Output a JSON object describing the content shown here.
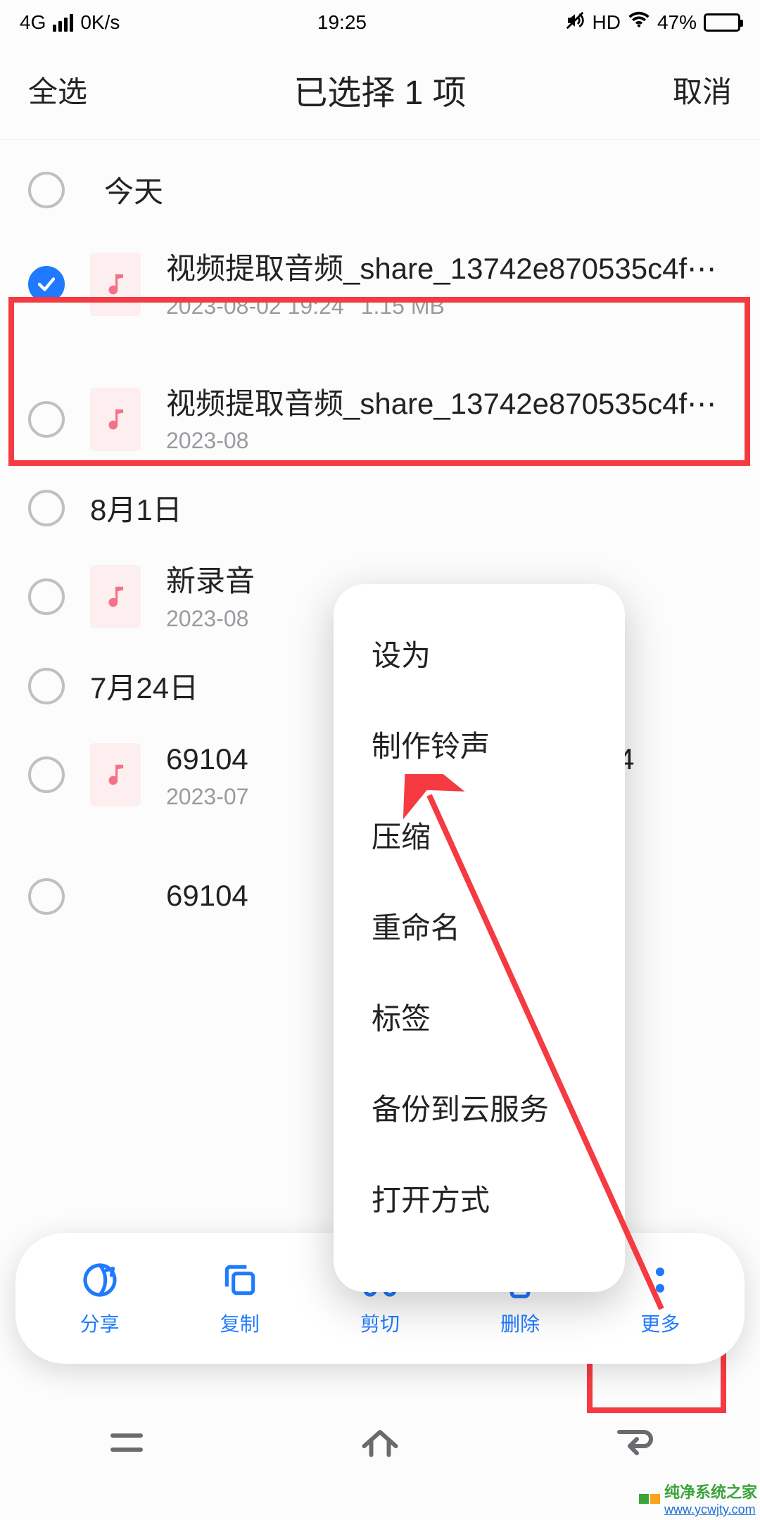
{
  "status_bar": {
    "network": "4G",
    "speed": "0K/s",
    "time": "19:25",
    "hd": "HD",
    "battery_pct": "47%"
  },
  "header": {
    "select_all": "全选",
    "title": "已选择 1 项",
    "cancel": "取消"
  },
  "sections": {
    "today": "今天",
    "aug1": "8月1日",
    "jul24": "7月24日"
  },
  "files": [
    {
      "name": "视频提取音频_share_13742e870535c4f⋯",
      "date": "2023-08-02 19:24",
      "size": "1.15 MB",
      "checked": true
    },
    {
      "name": "视频提取音频_share_13742e870535c4f⋯",
      "date": "2023-08",
      "size": "",
      "checked": false
    },
    {
      "name": "新录音",
      "date": "2023-08",
      "size": "",
      "checked": false
    },
    {
      "name": "69104                               20230724",
      "date": "2023-07",
      "size": "",
      "checked": false
    },
    {
      "name": "69104                               np3",
      "date": "",
      "size": "",
      "checked": false
    }
  ],
  "popup": {
    "items": [
      "设为",
      "制作铃声",
      "压缩",
      "重命名",
      "标签",
      "备份到云服务",
      "打开方式"
    ]
  },
  "bottom_bar": {
    "share": "分享",
    "copy": "复制",
    "cut": "剪切",
    "delete": "删除",
    "more": "更多"
  },
  "watermark": {
    "name": "纯净系统之家",
    "url": "www.ycwjty.com"
  }
}
